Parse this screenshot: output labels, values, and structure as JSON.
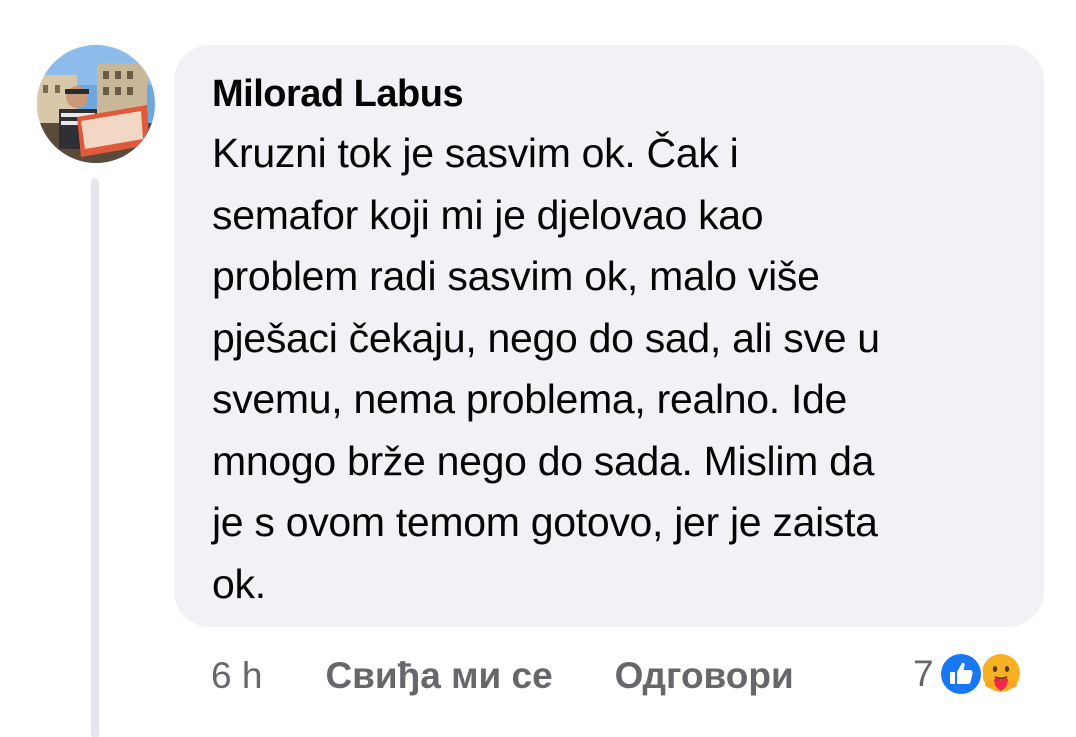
{
  "comment": {
    "author": "Milorad Labus",
    "text": "Kruzni tok je sasvim ok. Čak i\nsemafor koji mi je djelovao kao\nproblem radi sasvim ok,  malo više\npješaci čekaju, nego do sad, ali sve u\nsvemu, nema problema, realno. Ide\nmnogo brže nego do sada. Mislim da\nje s ovom temom gotovo, jer je zaista\nok.",
    "time": "6 h",
    "like_label": "Свиђа ми се",
    "reply_label": "Одговори",
    "reaction_count": "7",
    "reactions": [
      "like-icon",
      "care-icon"
    ]
  },
  "colors": {
    "bubble": "#f0f2f5",
    "text": "#050505",
    "secondary_text": "#65676b",
    "like_blue": "#1877f2",
    "care_yellow": "#f7b125"
  }
}
